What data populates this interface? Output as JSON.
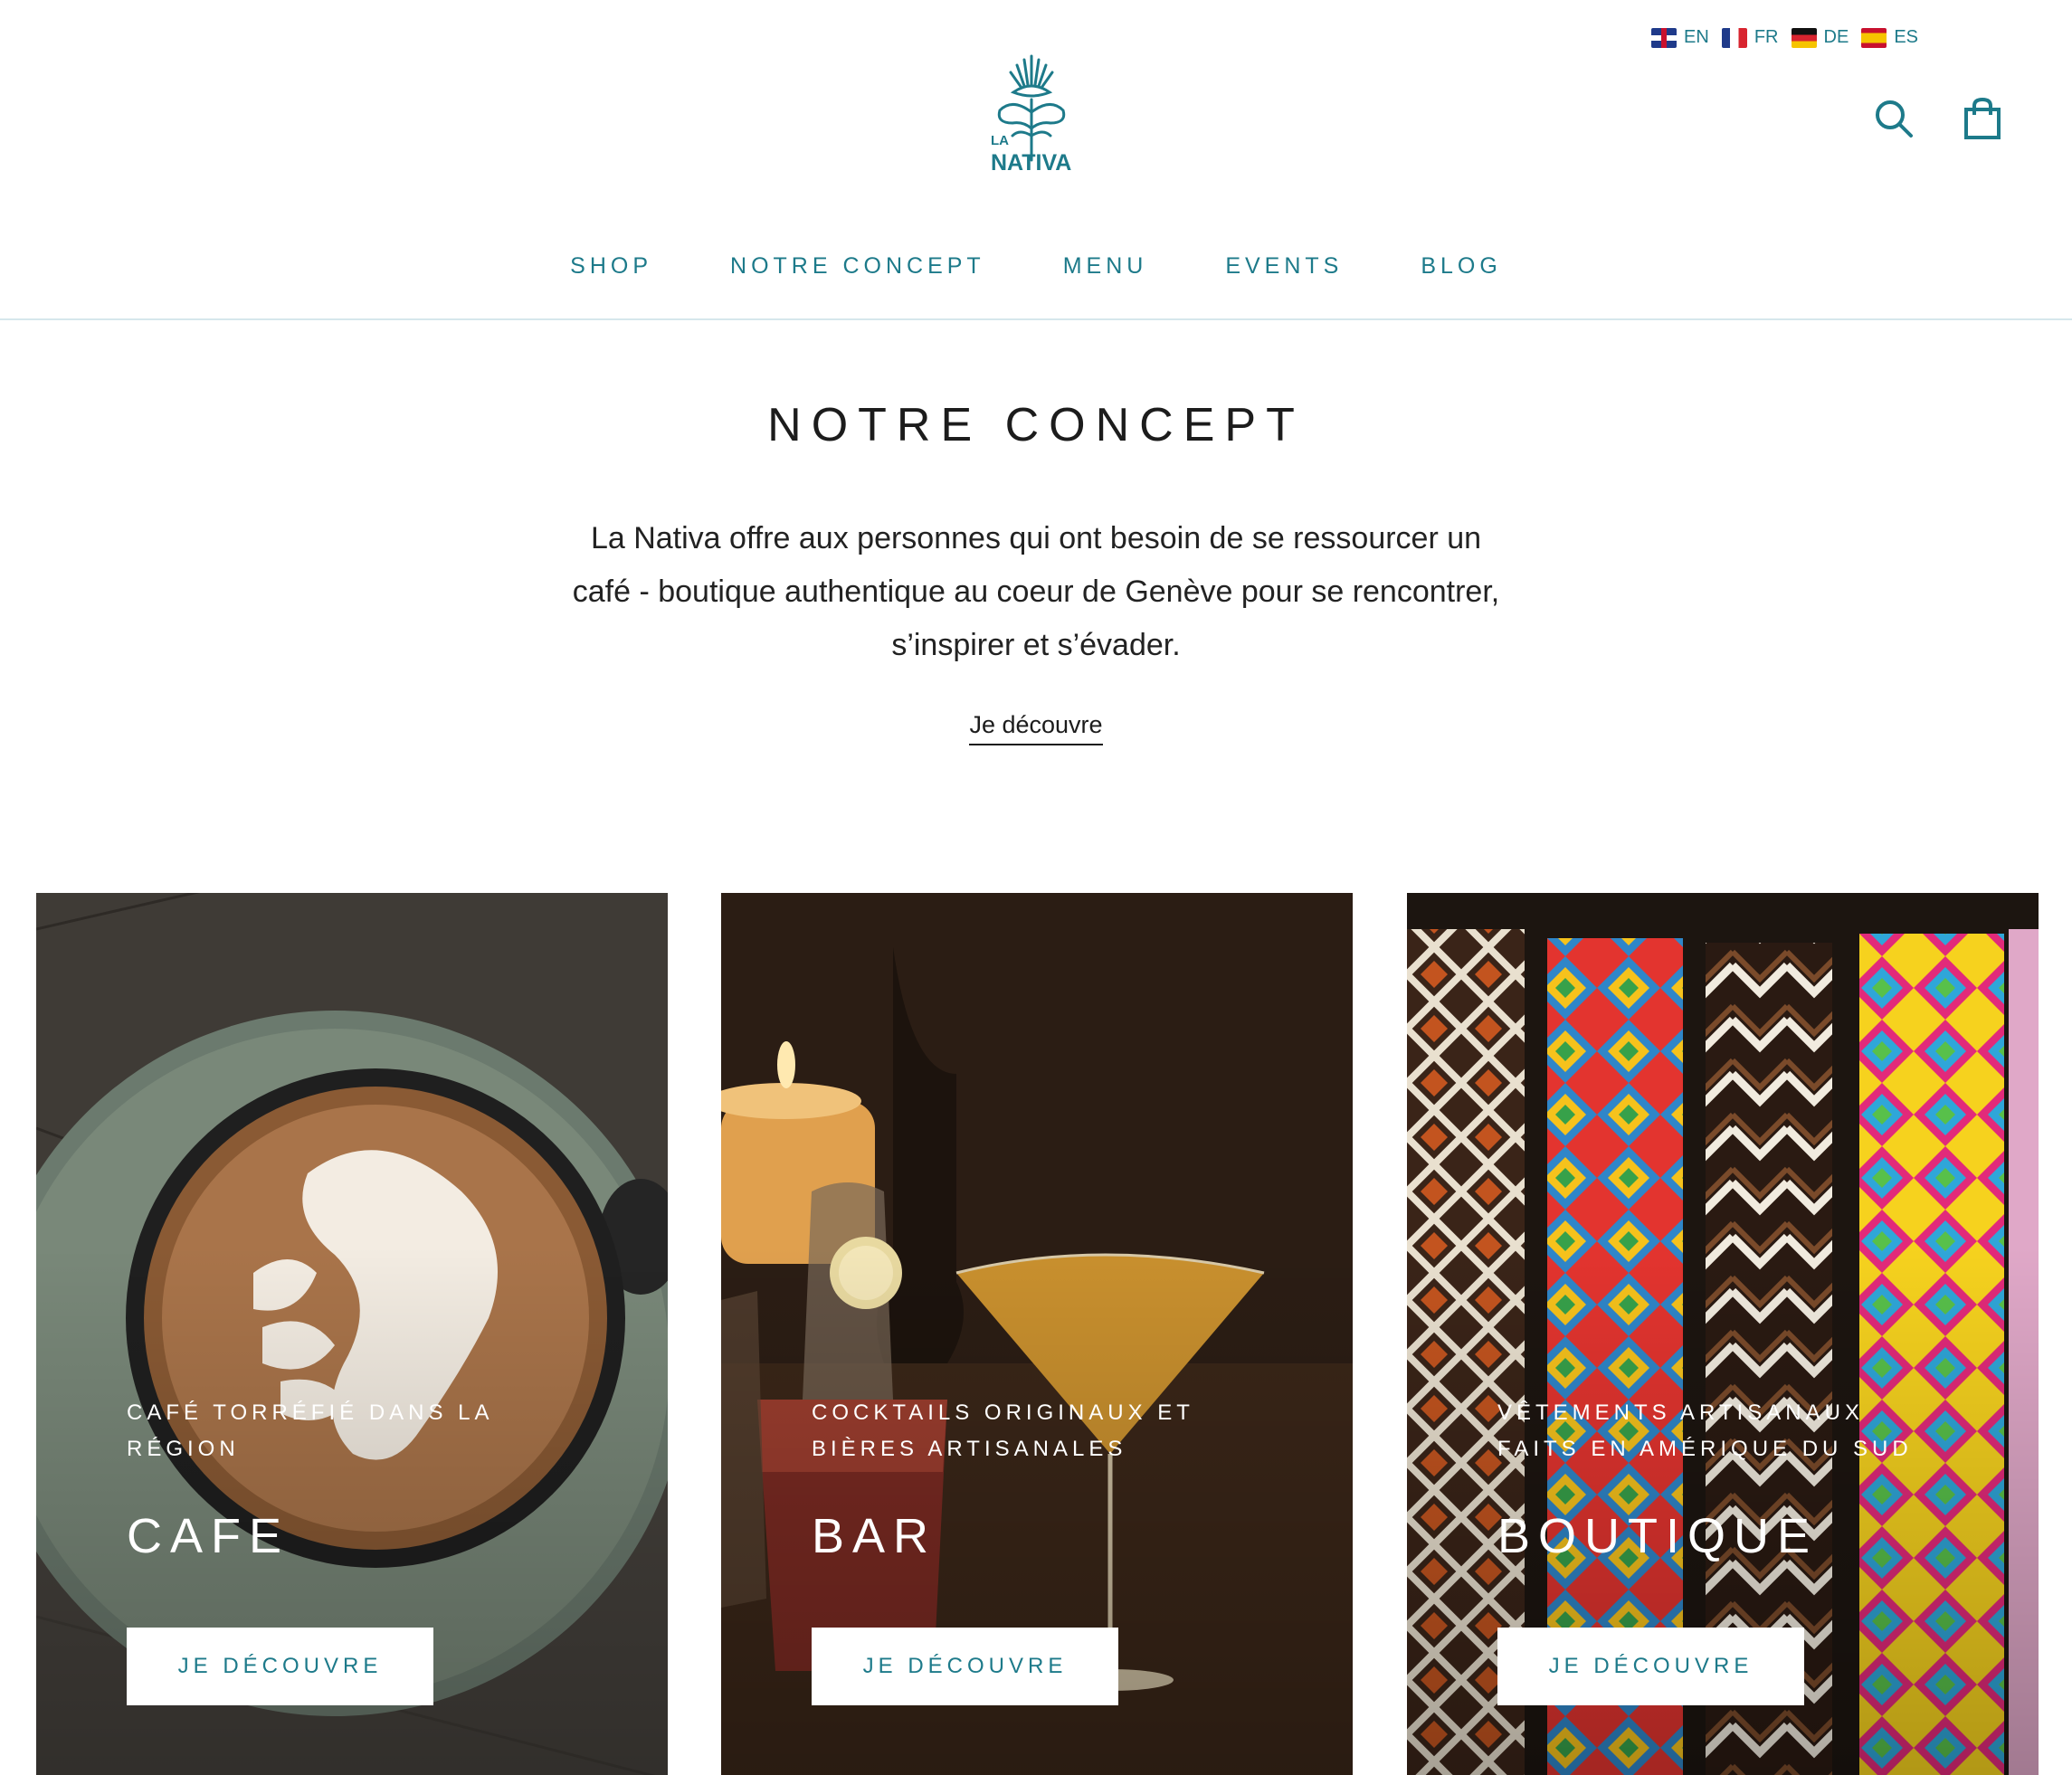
{
  "languages": [
    {
      "code": "EN",
      "flag": "flag-uk-icon"
    },
    {
      "code": "FR",
      "flag": "flag-fr-icon"
    },
    {
      "code": "DE",
      "flag": "flag-de-icon"
    },
    {
      "code": "ES",
      "flag": "flag-es-icon"
    }
  ],
  "brand": {
    "line1": "LA",
    "line2": "NATIVA",
    "color": "#1d7a8a"
  },
  "nav": {
    "items": [
      "SHOP",
      "NOTRE CONCEPT",
      "MENU",
      "EVENTS",
      "BLOG"
    ]
  },
  "intro": {
    "title": "NOTRE CONCEPT",
    "text": "La Nativa offre aux personnes qui ont besoin de se ressourcer un café - boutique authentique au coeur de Genève pour se rencontrer, s’inspirer et s’évader.",
    "link": "Je découvre"
  },
  "cards": [
    {
      "subtitle": "CAFÉ TORRÉFIÉ DANS LA RÉGION",
      "title": "CAFE",
      "button": "JE DÉCOUVRE",
      "image": "latte-art-cup-photo"
    },
    {
      "subtitle": "COCKTAILS ORIGINAUX ET BIÈRES ARTISANALES",
      "title": "BAR",
      "button": "JE DÉCOUVRE",
      "image": "cocktails-candle-photo"
    },
    {
      "subtitle": "VÊTEMENTS ARTISANAUX FAITS EN AMÉRIQUE DU SUD",
      "title": "BOUTIQUE",
      "button": "JE DÉCOUVRE",
      "image": "woven-straps-photo"
    }
  ],
  "icons": {
    "search": "search-icon",
    "cart": "shopping-bag-icon"
  }
}
